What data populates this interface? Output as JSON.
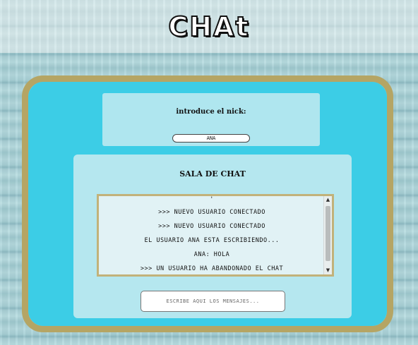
{
  "app": {
    "title": "CHAt"
  },
  "nick": {
    "label": "introduce el nick:",
    "value": "ANA"
  },
  "room": {
    "title": "SALA DE CHAT",
    "messages": [
      ">>> NUEVO USUARIO CONECTADO",
      ">>> NUEVO USUARIO CONECTADO",
      "EL USUARIO ANA ESTA ESCRIBIENDO...",
      "ANA: HOLA",
      ">>> UN USUARIO HA ABANDONADO EL CHAT"
    ]
  },
  "compose": {
    "placeholder": "ESCRIBE AQUI LOS MENSAJES..."
  },
  "icons": {
    "scroll_up": "chevron-up-icon",
    "scroll_down": "chevron-down-icon"
  },
  "colors": {
    "frame_border": "#b5a564",
    "frame_fill": "#3ccde6",
    "messages_border": "#c2b27a"
  }
}
